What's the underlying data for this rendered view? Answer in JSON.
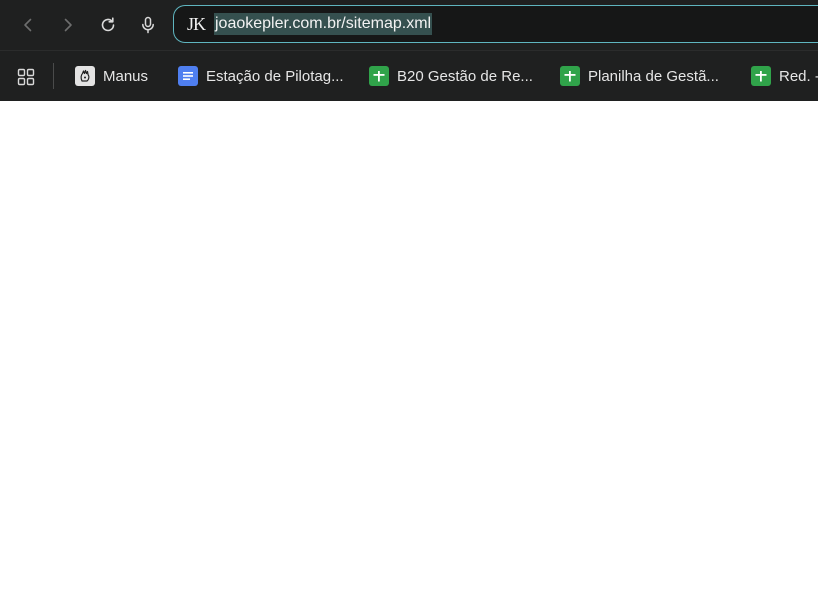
{
  "address_bar": {
    "site_logo": "JK",
    "url": "joaokepler.com.br/sitemap.xml"
  },
  "nav": {
    "back_icon": "chevron-left-icon",
    "forward_icon": "chevron-right-icon",
    "reload_icon": "reload-icon",
    "voice_icon": "microphone-icon"
  },
  "bookmarks": {
    "apps_icon": "apps-grid-icon",
    "items": [
      {
        "label": "Manus",
        "icon": "manus-icon"
      },
      {
        "label": "Estação de Pilotag...",
        "icon": "google-docs-icon"
      },
      {
        "label": "B20 Gestão de Re...",
        "icon": "google-sheets-icon"
      },
      {
        "label": "Planilha de Gestã...",
        "icon": "google-sheets-icon"
      },
      {
        "label": "Red. -",
        "icon": "google-sheets-icon"
      }
    ]
  },
  "colors": {
    "toolbar_bg": "#1f2020",
    "omnibox_border": "#5fb5bf",
    "url_highlight": "#35504f",
    "docs_blue": "#4f7ff0",
    "sheets_green": "#30a34a"
  }
}
